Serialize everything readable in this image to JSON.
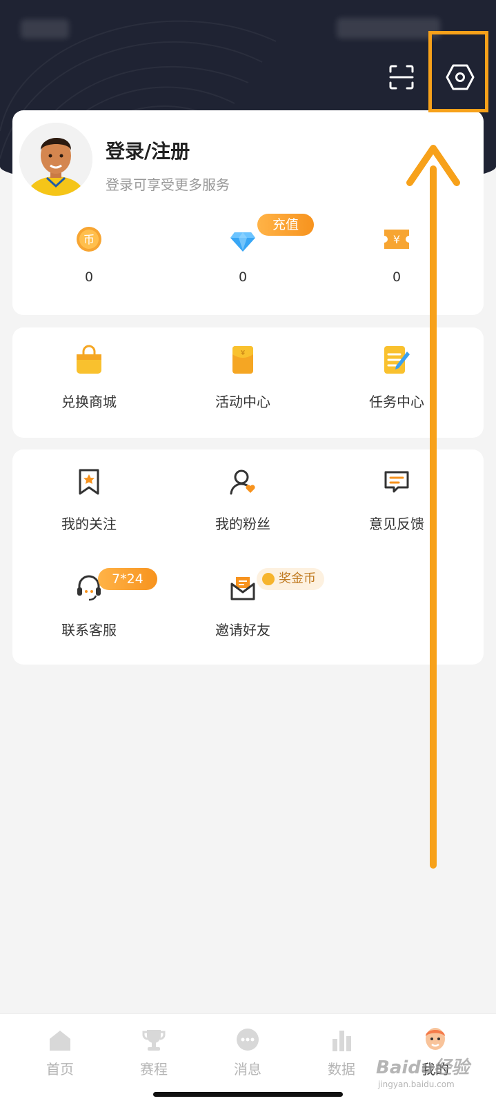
{
  "header": {
    "scan_icon": "scan-icon",
    "settings_icon": "settings-hexagon-icon"
  },
  "profile": {
    "title": "登录/注册",
    "subtitle": "登录可享受更多服务"
  },
  "wallet": {
    "items": [
      {
        "icon": "coin-icon",
        "value": "0"
      },
      {
        "icon": "diamond-icon",
        "value": "0"
      },
      {
        "icon": "ticket-icon",
        "value": "0"
      }
    ],
    "recharge_badge": "充值"
  },
  "services": {
    "items": [
      {
        "icon": "shopping-bag-icon",
        "label": "兑换商城"
      },
      {
        "icon": "red-packet-icon",
        "label": "活动中心"
      },
      {
        "icon": "task-notepad-icon",
        "label": "任务中心"
      }
    ]
  },
  "tools": {
    "items": [
      {
        "icon": "bookmark-star-icon",
        "label": "我的关注"
      },
      {
        "icon": "fans-icon",
        "label": "我的粉丝"
      },
      {
        "icon": "feedback-icon",
        "label": "意见反馈"
      },
      {
        "icon": "headset-icon",
        "label": "联系客服"
      },
      {
        "icon": "invite-envelope-icon",
        "label": "邀请好友"
      }
    ],
    "service_badge": "7*24",
    "invite_badge": "奖金币"
  },
  "tabbar": {
    "items": [
      {
        "icon": "home-icon",
        "label": "首页"
      },
      {
        "icon": "trophy-icon",
        "label": "赛程"
      },
      {
        "icon": "message-icon",
        "label": "消息"
      },
      {
        "icon": "bar-chart-icon",
        "label": "数据"
      },
      {
        "icon": "mine-avatar-icon",
        "label": "我的"
      }
    ],
    "active_index": 4
  },
  "watermark": {
    "brand": "Baidu经验",
    "url": "jingyan.baidu.com"
  },
  "colors": {
    "accent": "#f7931e",
    "annotation": "#f7a11a",
    "header_bg": "#1f2333"
  }
}
